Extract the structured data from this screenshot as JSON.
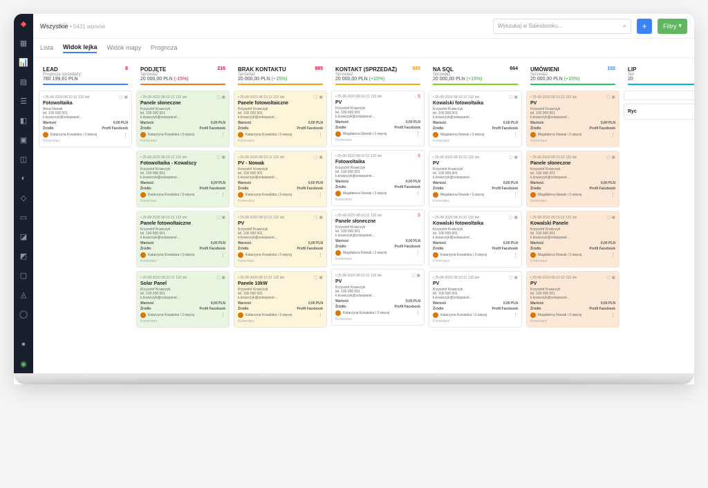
{
  "breadcrumb": {
    "main": "Wszystkie",
    "sub": "• 5431 wpisów"
  },
  "search": {
    "placeholder": "Wyszukaj w Salesbooku…"
  },
  "filter_btn": "Filtry",
  "tabs": [
    "Lista",
    "Widok lejka",
    "Widok mapy",
    "Prognoza"
  ],
  "active_tab": 1,
  "columns": [
    {
      "name": "LEAD",
      "count": 8,
      "count_class": "count-red",
      "sub": "Prognoza sprzedaży:",
      "val": "780 199,61 PLN",
      "change": "",
      "bar": "#3b82f6",
      "cards": [
        {
          "c": "",
          "title": "Fotowoltaika",
          "who": "Anna Nowak",
          "user": "Katarzyna Kowalska i 3 więcej",
          "icon": ""
        }
      ]
    },
    {
      "name": "PODJĘTE",
      "count": 216,
      "count_class": "count-red",
      "sub": "Sprzedaż",
      "val": "20 000,00 PLN",
      "change": "(-15%)",
      "chneg": true,
      "bar": "#f97316",
      "cards": [
        {
          "c": "green",
          "title": "Panele słoneczne",
          "who": "Krzysztof Krawczyk",
          "user": "Katarzyna Kowalska i 3 więcej"
        },
        {
          "c": "green",
          "title": "Fotowoltaika - Kowalscy",
          "who": "Krzysztof Krawczyk",
          "user": "Katarzyna Kowalska i 3 więcej"
        },
        {
          "c": "green",
          "title": "Panele fotowoltaiczne",
          "who": "Krzysztof Krawczyk",
          "user": "Katarzyna Kowalska i 3 więcej"
        },
        {
          "c": "green",
          "title": "Solar Panel",
          "who": "Krzysztof Krawczyk",
          "user": "Katarzyna Kowalska i 3 więcej"
        }
      ]
    },
    {
      "name": "BRAK KONTAKTU",
      "count": 985,
      "count_class": "count-red",
      "sub": "Sprzedaż",
      "val": "20 000,00 PLN",
      "change": "(+15%)",
      "bar": "#f59e0b",
      "cards": [
        {
          "c": "yellow",
          "title": "Panele fotowoltaiczne",
          "who": "Krzysztof Krawczyk",
          "user": "Katarzyna Kowalska i 3 więcej"
        },
        {
          "c": "yellow",
          "title": "PV - Nowak",
          "who": "Krzysztof Krawczyk",
          "user": "Katarzyna Kowalska i 3 więcej"
        },
        {
          "c": "yellow",
          "title": "PV",
          "who": "Krzysztof Krawczyk",
          "user": "Katarzyna Kowalska i 3 więcej"
        },
        {
          "c": "yellow",
          "title": "Panele 10kW",
          "who": "Krzysztof Krawczyk",
          "user": "Katarzyna Kowalska i 3 więcej"
        }
      ]
    },
    {
      "name": "KONTAKT (SPRZEDAŻ)",
      "count": 680,
      "count_class": "count-orange",
      "sub": "Sprzedaż",
      "val": "20 000,00 PLN",
      "change": "(+15%)",
      "bar": "#eab308",
      "cards": [
        {
          "c": "",
          "title": "PV",
          "who": "Krzysztof Krawczyk",
          "user": "Magdalena Nowak i 3 więcej",
          "icon": "S"
        },
        {
          "c": "",
          "title": "Fotowoltaika",
          "who": "Krzysztof Krawczyk",
          "user": "Magdalena Nowak i 3 więcej",
          "icon": "S"
        },
        {
          "c": "",
          "title": "Panele słoneczne",
          "who": "Krzysztof Krawczyk",
          "user": "Magdalena Nowak i 3 więcej",
          "icon": "S"
        },
        {
          "c": "",
          "title": "PV",
          "who": "Krzysztof Krawczyk",
          "user": "Katarzyna Kowalska i 3 więcej"
        }
      ]
    },
    {
      "name": "NA SQL",
      "count": 664,
      "count_class": "",
      "sub": "Sprzedaż",
      "val": "20 000,00 PLN",
      "change": "(+15%)",
      "bar": "#84cc16",
      "cards": [
        {
          "c": "",
          "title": "Kowalski fotowoltaika",
          "who": "Krzysztof Krawczyk",
          "user": "Magdalena Nowak i 3 więcej"
        },
        {
          "c": "",
          "title": "PV",
          "who": "Krzysztof Krawczyk",
          "user": "Magdalena Nowak i 3 więcej"
        },
        {
          "c": "",
          "title": "Kowalski fotowoltaika",
          "who": "Krzysztof Krawczyk",
          "user": "Katarzyna Kowalska i 3 więcej"
        },
        {
          "c": "",
          "title": "PV",
          "who": "Krzysztof Krawczyk",
          "user": "Katarzyna Kowalska i 3 więcej"
        }
      ]
    },
    {
      "name": "UMÓWIENI",
      "count": 102,
      "count_class": "count-blue",
      "sub": "Sprzedaż",
      "val": "20 000,00 PLN",
      "change": "(+15%)",
      "bar": "#22c55e",
      "cards": [
        {
          "c": "orange",
          "title": "PV",
          "who": "Krzysztof Krawczyk",
          "user": "Magdalena Nowak i 3 więcej"
        },
        {
          "c": "orange",
          "title": "Panele słoneczne",
          "who": "Krzysztof Krawczyk",
          "user": "Magdalena Nowak i 3 więcej"
        },
        {
          "c": "orange",
          "title": "Kowalski Panele",
          "who": "Krzysztof Krawczyk",
          "user": "Magdalena Nowak i 3 więcej"
        },
        {
          "c": "orange",
          "title": "PV",
          "who": "Krzysztof Krawczyk",
          "user": "Magdalena Nowak i 3 więcej"
        }
      ]
    },
    {
      "name": "LIP",
      "count": "",
      "count_class": "",
      "sub": "Spr",
      "val": "20",
      "change": "",
      "bar": "#06b6d4",
      "cards": [
        {
          "c": "",
          "title": "",
          "who": "",
          "user": "",
          "partial": true
        },
        {
          "c": "",
          "title": "Ryc",
          "who": "",
          "user": "",
          "partial": true
        }
      ]
    }
  ],
  "card_meta": {
    "date": "• 25-08-2020 08:10:12  132 dni",
    "phone": "tel. 100 000 001",
    "email": "k.krawczyk@solarpanel…",
    "wartosc_label": "Wartość",
    "wartosc_val": "0,00 PLN",
    "zrodlo_label": "Źródło",
    "zrodlo_val": "Profil Facebook",
    "comment": "Komentarz"
  }
}
